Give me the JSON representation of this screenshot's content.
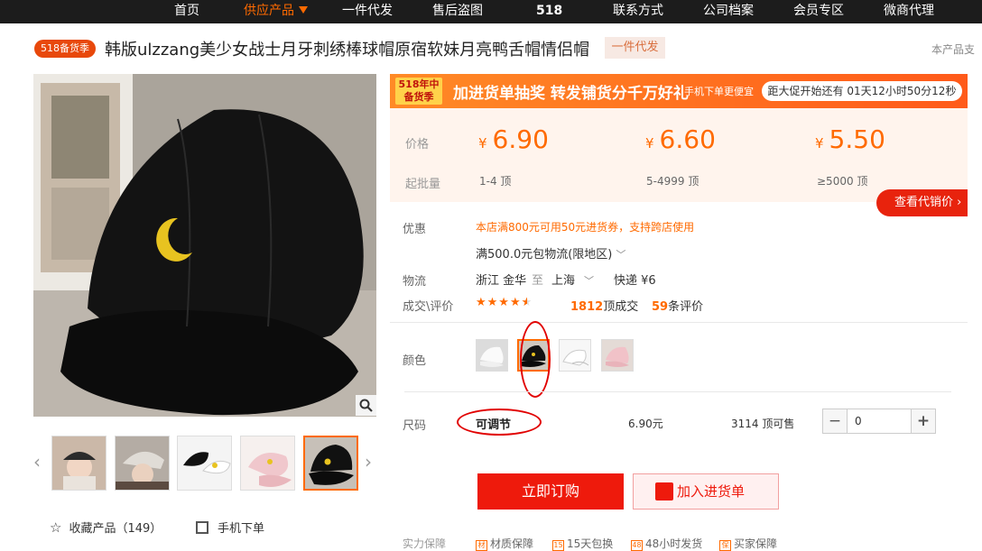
{
  "nav": {
    "items": [
      "首页",
      "供应产品",
      "一件代发",
      "售后盗图",
      "518",
      "联系方式",
      "公司档案",
      "会员专区",
      "微商代理"
    ],
    "active_index": 1
  },
  "badge": "518备货季",
  "product_title": "韩版ulzzang美少女战士月牙刺绣棒球帽原宿软妹月亮鸭舌帽情侣帽",
  "product_tag": "一件代发",
  "support_text": "本产品支",
  "promo": {
    "logo_line1": "518年中",
    "logo_line2": "备货季",
    "text": "加进货单抽奖 转发铺货分千万好礼",
    "sub": "手机下单更便宜",
    "countdown": "距大促开始还有 01天12小时50分12秒"
  },
  "pricing": {
    "price_label": "价格",
    "qty_label": "起批量",
    "currency": "¥",
    "tiers": [
      {
        "price": "6.90",
        "qty": "1-4 顶"
      },
      {
        "price": "6.60",
        "qty": "5-4999 顶"
      },
      {
        "price": "5.50",
        "qty": "≥5000 顶"
      }
    ],
    "quote_button": "查看代销价 ›"
  },
  "discount": {
    "label": "优惠",
    "text": "本店满800元可用50元进货券，支持跨店使用",
    "free_shipping": "满500.0元包物流(限地区)"
  },
  "logistics": {
    "label": "物流",
    "from": "浙江 金华",
    "to_word": "至",
    "to": "上海",
    "express": "快递 ¥6"
  },
  "reviews": {
    "label": "成交\\评价",
    "rating": 4.5,
    "deals_count": "1812",
    "deals_suffix": "顶成交",
    "reviews_count": "59",
    "reviews_suffix": "条评价"
  },
  "color": {
    "label": "颜色",
    "selected_index": 1
  },
  "size": {
    "label": "尺码",
    "value": "可调节",
    "price": "6.90元",
    "stock": "3114 顶可售",
    "quantity": "0"
  },
  "buttons": {
    "order": "立即订购",
    "cart": "加入进货单"
  },
  "favorites": "收藏产品（149）",
  "mobile_order": "手机下单",
  "guarantee": {
    "label": "实力保障",
    "items": [
      "材质保障",
      "15天包换",
      "48小时发货",
      "买家保障"
    ]
  },
  "colors": {
    "accent": "#ff6a00",
    "primary_red": "#ee1a0c",
    "nav_bg": "#1c1c1c"
  }
}
